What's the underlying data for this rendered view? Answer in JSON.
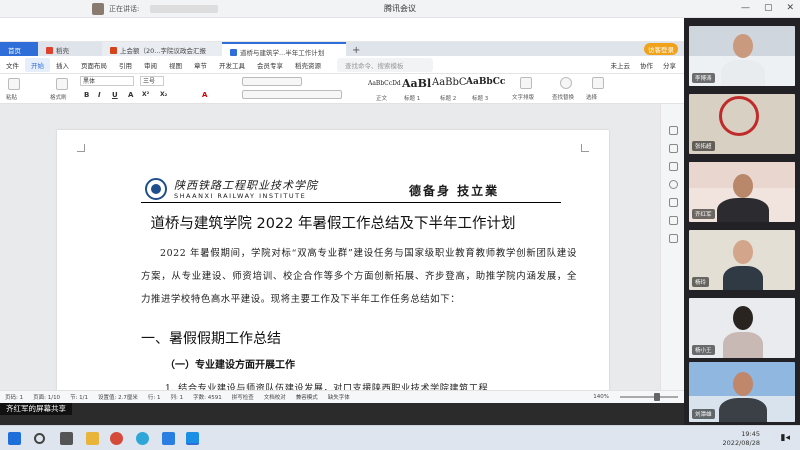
{
  "window": {
    "app_title": "腾讯会议",
    "speaking_label": "正在讲话:",
    "controls": [
      "—",
      "▢",
      "✕"
    ]
  },
  "wps": {
    "tabs": [
      {
        "label": "首页"
      },
      {
        "label": "稻壳"
      },
      {
        "label": "上会额（20...字院议政会汇报"
      },
      {
        "label": "道桥与建筑学...半年工作计划"
      }
    ],
    "add_tab": "+",
    "login_button": "访客登录",
    "menu": [
      "文件",
      "开始",
      "插入",
      "页面布局",
      "引用",
      "审阅",
      "视图",
      "章节",
      "开发工具",
      "会员专享",
      "稻壳资源"
    ],
    "search_placeholder": "查找命令、搜索模板",
    "menu_right": [
      "未上云",
      "协作",
      "分享"
    ],
    "font_name": "黑体",
    "font_size": "三号",
    "left_tools": [
      "粘贴",
      "格式刷"
    ],
    "styles": [
      {
        "preview": "AaBbCcDd",
        "caption": "正文"
      },
      {
        "preview": "AaBl",
        "caption": "标题 1"
      },
      {
        "preview": "AaBbC",
        "caption": "标题 2"
      },
      {
        "preview": "AaBbCc",
        "caption": "标题 3"
      }
    ],
    "format_buttons": [
      "B",
      "I",
      "U",
      "A",
      "X²",
      "X₂",
      "A"
    ],
    "right_tools": [
      "文字排版",
      "查找替换",
      "选择"
    ]
  },
  "document": {
    "school_name_cn": "陕西铁路工程职业技术学院",
    "school_name_en": "SHAANXI RAILWAY INSTITUTE",
    "motto": "德备身 技立業",
    "title": "道桥与建筑学院 2022 年暑假工作总结及下半年工作计划",
    "intro": "2022 年暑假期间，学院对标“双高专业群”建设任务与国家级职业教育教师教学创新团队建设方案，从专业建设、师资培训、校企合作等多个方面创新拓展、齐步登高，助推学院内涵发展，全力推进学校特色高水平建设。现将主要工作及下半年工作任务总结如下：",
    "heading1": "一、暑假假期工作总结",
    "heading2": "（一）专业建设方面开展工作",
    "line1": "1. 结合专业建设与师资队伍建设发展，对口支援陕西职业技术学院建筑工程"
  },
  "status_bar": {
    "page": "页码: 1",
    "pages": "页面: 1/10",
    "section": "节: 1/1",
    "setting": "设置值: 2.7厘米",
    "row": "行: 1",
    "col": "列: 1",
    "words": "字数: 4591",
    "spell": "拼写检查",
    "proof": "文档校对",
    "compat": "兼容模式",
    "missing_font": "缺失字体",
    "zoom": "140%"
  },
  "share_banner": "齐红军的屏幕共享",
  "participants": [
    {
      "name": "李博涛"
    },
    {
      "name": "张拓超"
    },
    {
      "name": "齐红军"
    },
    {
      "name": "杨玲"
    },
    {
      "name": "杨小王"
    },
    {
      "name": "刘潭雄"
    }
  ],
  "taskbar": {
    "time": "19:45",
    "date": "2022/08/28"
  },
  "colors": {
    "wps_blue": "#2f6ed8",
    "login_orange": "#f0a21b",
    "panel_bg": "#222226"
  }
}
